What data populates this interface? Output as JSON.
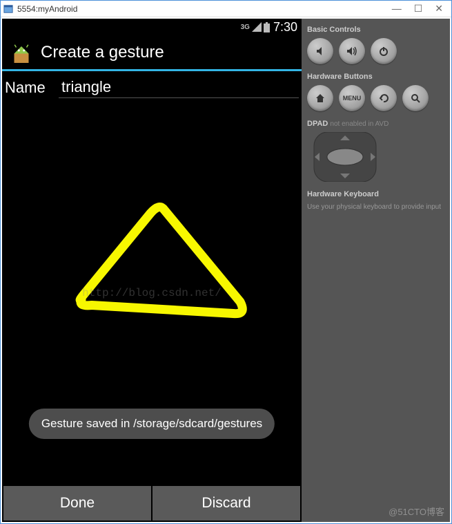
{
  "window": {
    "title": "5554:myAndroid"
  },
  "statusbar": {
    "network": "3G",
    "time": "7:30"
  },
  "actionbar": {
    "title": "Create a gesture"
  },
  "form": {
    "name_label": "Name",
    "name_value": "triangle"
  },
  "watermark": "http://blog.csdn.net/",
  "toast": {
    "message": "Gesture saved in /storage/sdcard/gestures"
  },
  "buttons": {
    "done": "Done",
    "discard": "Discard"
  },
  "sidepanel": {
    "basic_controls": "Basic Controls",
    "hardware_buttons": "Hardware Buttons",
    "menu_label": "MENU",
    "dpad_label": "DPAD",
    "dpad_note": "not enabled in AVD",
    "keyboard_title": "Hardware Keyboard",
    "keyboard_note": "Use your physical keyboard to provide input"
  },
  "attribution": "@51CTO博客",
  "gesture": {
    "shape": "triangle",
    "color": "#f7f700"
  }
}
